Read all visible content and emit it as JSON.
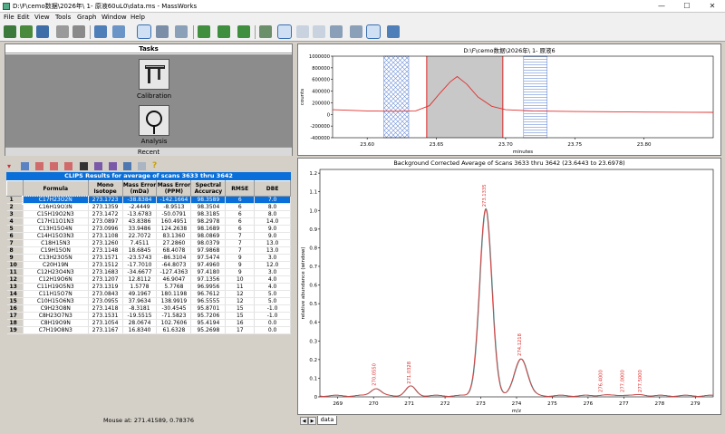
{
  "window": {
    "title": "D:\\F\\cemo数据\\2026年\\           1-        原液60uL0\\data.ms - MassWorks"
  },
  "menu": [
    "File",
    "Edit",
    "View",
    "Tools",
    "Graph",
    "Window",
    "Help"
  ],
  "tasks": {
    "header": "Tasks",
    "items": [
      {
        "label": "Calibration",
        "icon": "caliper-icon"
      },
      {
        "label": "Analysis",
        "icon": "magnifier-icon"
      }
    ],
    "recent_label": "Recent"
  },
  "clips": {
    "title": "CLIPS Results for average of scans 3633 thru 3642",
    "columns": [
      "",
      "Formula",
      "Mono Isotope",
      "Mass Error (mDa)",
      "Mass Error (PPM)",
      "Spectral Accuracy",
      "RMSE",
      "DBE"
    ],
    "rows": [
      [
        "1",
        "C17H23O2N",
        "273.1723",
        "-38.8384",
        "-142.1664",
        "98.3589",
        "6",
        "7.0"
      ],
      [
        "2",
        "C16H19O3N",
        "273.1359",
        "-2.4449",
        "-8.9513",
        "98.3504",
        "6",
        "8.0"
      ],
      [
        "3",
        "C15H19O2N3",
        "273.1472",
        "-13.6783",
        "-50.0791",
        "98.3185",
        "6",
        "8.0"
      ],
      [
        "4",
        "C17H11O1N3",
        "273.0897",
        "43.8386",
        "160.4951",
        "98.2978",
        "6",
        "14.0"
      ],
      [
        "5",
        "C13H15O4N",
        "273.0996",
        "33.9486",
        "124.2638",
        "98.1689",
        "6",
        "9.0"
      ],
      [
        "6",
        "C14H15O3N3",
        "273.1108",
        "22.7072",
        "83.1360",
        "98.0869",
        "7",
        "9.0"
      ],
      [
        "7",
        "C18H15N3",
        "273.1260",
        "7.4511",
        "27.2860",
        "98.0379",
        "7",
        "13.0"
      ],
      [
        "8",
        "C19H15ON",
        "273.1148",
        "18.6845",
        "68.4078",
        "97.9868",
        "7",
        "13.0"
      ],
      [
        "9",
        "C13H23O5N",
        "273.1571",
        "-23.5743",
        "-86.3104",
        "97.5474",
        "9",
        "3.0"
      ],
      [
        "10",
        "C20H19N",
        "273.1512",
        "-17.7010",
        "-64.8073",
        "97.4960",
        "9",
        "12.0"
      ],
      [
        "11",
        "C12H23O4N3",
        "273.1683",
        "-34.6677",
        "-127.4363",
        "97.4180",
        "9",
        "3.0"
      ],
      [
        "12",
        "C12H19O6N",
        "273.1207",
        "12.8112",
        "46.9047",
        "97.1356",
        "10",
        "4.0"
      ],
      [
        "13",
        "C11H19O5N3",
        "273.1319",
        "1.5778",
        "5.7768",
        "96.9956",
        "11",
        "4.0"
      ],
      [
        "14",
        "C11H15O7N",
        "273.0843",
        "49.1967",
        "180.1198",
        "96.7612",
        "12",
        "5.0"
      ],
      [
        "15",
        "C10H15O6N3",
        "273.0955",
        "37.9634",
        "138.9919",
        "96.5555",
        "12",
        "5.0"
      ],
      [
        "16",
        "C9H23O8N",
        "273.1418",
        "-8.3181",
        "-30.4545",
        "95.8701",
        "15",
        "-1.0"
      ],
      [
        "17",
        "C8H23O7N3",
        "273.1531",
        "-19.5515",
        "-71.5823",
        "95.7206",
        "15",
        "-1.0"
      ],
      [
        "18",
        "C8H19O9N",
        "273.1054",
        "28.0674",
        "102.7606",
        "95.4194",
        "16",
        "0.0"
      ],
      [
        "19",
        "C7H19O8N3",
        "273.1167",
        "16.8340",
        "61.6328",
        "95.2698",
        "17",
        "0.0"
      ]
    ]
  },
  "status": {
    "mouse": "Mouse at: 271.41589, 0.78376"
  },
  "tic_panel": {
    "title": "D:\\F\\cemo数据\\2026年\\           1-               原液6",
    "chart_data": {
      "type": "line",
      "xlabel": "minutes",
      "ylabel": "counts",
      "xlim": [
        23.575,
        23.85
      ],
      "ylim": [
        -400000,
        1000000
      ],
      "xticks": [
        "23.60",
        "23.65",
        "23.70",
        "23.75",
        "23.80"
      ],
      "yticks": [
        "1000000",
        "800000",
        "600000",
        "400000",
        "200000",
        "0",
        "-200000",
        "-400000"
      ],
      "x": [
        23.575,
        23.6,
        23.62,
        23.635,
        23.645,
        23.652,
        23.66,
        23.665,
        23.672,
        23.68,
        23.69,
        23.7,
        23.72,
        23.75,
        23.8,
        23.85
      ],
      "y": [
        80000,
        60000,
        55000,
        60000,
        150000,
        350000,
        560000,
        650000,
        520000,
        300000,
        140000,
        80000,
        60000,
        50000,
        40000,
        35000
      ],
      "regions": [
        {
          "kind": "background",
          "x": [
            23.612,
            23.63
          ]
        },
        {
          "kind": "selection",
          "x": [
            23.643,
            23.698
          ]
        },
        {
          "kind": "background",
          "x": [
            23.713,
            23.73
          ]
        }
      ],
      "grid": false
    }
  },
  "spectrum_panel": {
    "title": "Background Corrected Average of Scans 3633 thru 3642 (23.6443 to 23.6978)",
    "chart_data": {
      "type": "line",
      "xlabel": "m/z",
      "ylabel": "relative abundance (window)",
      "xlim": [
        268.5,
        279.5
      ],
      "ylim": [
        0,
        1.22
      ],
      "xticks": [
        269,
        270,
        271,
        272,
        273,
        274,
        275,
        276,
        277,
        278,
        279
      ],
      "yticks": [
        "0",
        "0.1",
        "0.2",
        "0.3",
        "0.4",
        "0.5",
        "0.6",
        "0.7",
        "0.8",
        "0.9",
        "1.0",
        "1.1",
        "1.2"
      ],
      "peaks": [
        {
          "mz": 270.055,
          "height": 0.04,
          "label": "270.0550"
        },
        {
          "mz": 271.0328,
          "height": 0.05,
          "label": "271.0328"
        },
        {
          "mz": 273.1335,
          "height": 1.0,
          "label": "273.1335"
        },
        {
          "mz": 274.1218,
          "height": 0.2,
          "label": "274.1218"
        },
        {
          "mz": 276.4,
          "height": 0.005,
          "label": "276.4000"
        },
        {
          "mz": 277.0,
          "height": 0.005,
          "label": "277.0000"
        },
        {
          "mz": 277.5,
          "height": 0.005,
          "label": "277.5000"
        }
      ],
      "grid": false
    }
  },
  "tabs": {
    "active": "data"
  }
}
